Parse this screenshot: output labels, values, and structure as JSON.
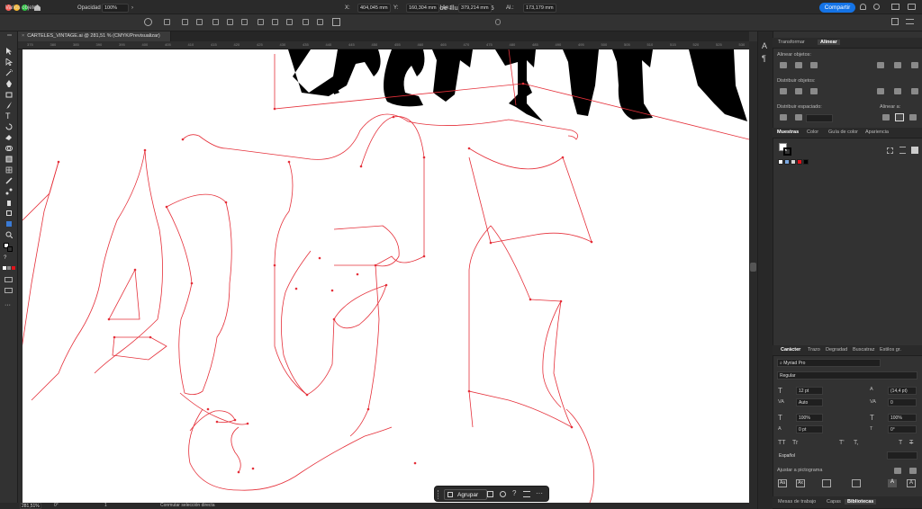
{
  "app": {
    "title": "Adobe Illustrator 2025",
    "share_label": "Compartir"
  },
  "control": {
    "selection": "Varios objetos",
    "opacity_label": "Opacidad",
    "opacity_value": "100%",
    "x_label": "X:",
    "x_value": "404,045 mm",
    "y_label": "Y:",
    "y_value": "160,304 mm",
    "w_label": "An.:",
    "w_value": "379,214 mm",
    "h_label": "Al.:",
    "h_value": "173,179 mm"
  },
  "document": {
    "tab_title": "CARTELES_VINTAGE.ai @ 281,51 % (CMYK/Previsualizar)"
  },
  "ruler": {
    "ticks": [
      "375",
      "380",
      "385",
      "390",
      "395",
      "400",
      "405",
      "410",
      "415",
      "420",
      "425",
      "430",
      "435",
      "440",
      "445",
      "450",
      "455",
      "460",
      "465",
      "470",
      "475",
      "480",
      "485",
      "490",
      "495",
      "500",
      "505",
      "510",
      "515",
      "520",
      "525",
      "530"
    ]
  },
  "status": {
    "zoom": "281,51%",
    "rotation": "0°",
    "artboard": "1",
    "tool_hint": "Conmutar selección directa"
  },
  "context_bar": {
    "group_label": "Agrupar"
  },
  "panels": {
    "top_tabs": [
      "Transformar",
      "Alinear"
    ],
    "align_objects": "Alinear objetos:",
    "distribute_objects": "Distribuir objetos:",
    "distribute_spacing": "Distribuir espaciado:",
    "align_to": "Alinear a:",
    "swatch_tabs": [
      "Muestras",
      "Color",
      "Guía de color",
      "Apariencia"
    ],
    "swatch_colors": [
      "#ffffff",
      "#7aa7e0",
      "#d3d3d3",
      "#e0141b",
      "#000000"
    ],
    "char_tabs": [
      "Carácter",
      "Trazo",
      "Degradad",
      "Buscatraz",
      "Estilos gr."
    ],
    "font_family": "Myriad Pro",
    "font_style": "Regular",
    "font_size": "12 pt",
    "leading": "(14,4 pt)",
    "kerning": "Auto",
    "tracking": "0",
    "vscale": "100%",
    "hscale": "100%",
    "baseline": "0 pt",
    "rotation": "0°",
    "language": "Español",
    "snap_label": "Ajustar a pictograma",
    "bottom_tabs": [
      "Mesas de trabajo",
      "Capas",
      "Bibliotecas"
    ]
  }
}
